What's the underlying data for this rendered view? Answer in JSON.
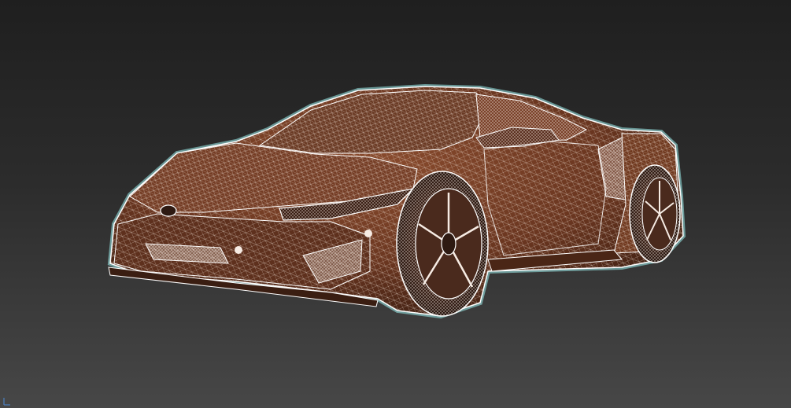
{
  "viewport": {
    "shading_mode": "wireframe-over-shaded",
    "model": {
      "subject": "sports-car",
      "body_color": "#6e3a22",
      "wire_color": "#f3e6dc",
      "selection_outline_color": "#9ff3f0"
    },
    "background": {
      "top_color": "#1f1f1f",
      "bottom_color": "#474747"
    },
    "gizmo": {
      "icon": "axis-tripod-icon",
      "color": "#4b7fbf"
    }
  }
}
